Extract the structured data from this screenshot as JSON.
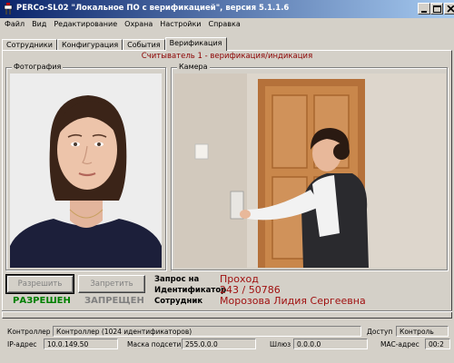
{
  "window": {
    "title": "PERCo-SL02 \"Локальное ПО с верификацией\", версия 5.1.1.6"
  },
  "menu": [
    "Файл",
    "Вид",
    "Редактирование",
    "Охрана",
    "Настройки",
    "Справка"
  ],
  "tabs": [
    {
      "label": "Сотрудники",
      "active": false
    },
    {
      "label": "Конфигурация",
      "active": false
    },
    {
      "label": "События",
      "active": false
    },
    {
      "label": "Верификация",
      "active": true
    }
  ],
  "verification": {
    "reader_title": "Считыватель 1 - верификация/индикация",
    "photo_label": "Фотография",
    "camera_label": "Камера",
    "allow_button": "Разрешить",
    "deny_button": "Запретить",
    "status_allowed": "РАЗРЕШЕН",
    "status_denied": "ЗАПРЕЩЕН",
    "request_label": "Запрос на",
    "request_value": "Проход",
    "identifier_label": "Идентификатор",
    "identifier_value": "243 / 50786",
    "employee_label": "Сотрудник",
    "employee_value": "Морозова Лидия Сергеевна"
  },
  "statusbar": {
    "controller_label": "Контроллер",
    "controller_value": "Контроллер (1024 идентификаторов)",
    "access_label": "Доступ",
    "access_value": "Контроль",
    "ip_label": "IP-адрес",
    "ip_value": "10.0.149.50",
    "mask_label": "Маска подсети",
    "mask_value": "255.0.0.0",
    "gateway_label": "Шлюз",
    "gateway_value": "0.0.0.0",
    "mac_label": "MAC-адрес",
    "mac_value": "00:2"
  },
  "colors": {
    "title_gradient_start": "#0a246a",
    "title_gradient_end": "#a6caf0",
    "window_bg": "#d4d0c8",
    "allowed": "#008000",
    "denied": "#808080",
    "info_value": "#a01010",
    "reader_title": "#8b0000"
  }
}
